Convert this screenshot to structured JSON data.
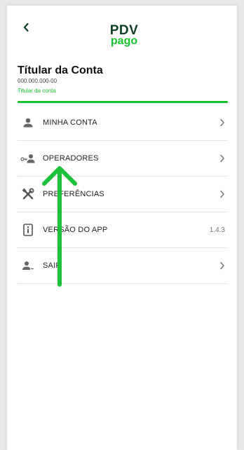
{
  "header": {
    "back_icon": "chevron-left-icon",
    "logo_line1": "PDV",
    "logo_line2": "pago"
  },
  "account": {
    "name": "Títular da Conta",
    "document": "000.000.000-00",
    "subtitle": "Titular da conta"
  },
  "menu": {
    "items": [
      {
        "label": "MINHA CONTA",
        "icon": "person-icon",
        "right": "chevron-right-icon"
      },
      {
        "label": "OPERADORES",
        "icon": "key-person-icon",
        "right": "chevron-right-icon"
      },
      {
        "label": "PREFERÊNCIAS",
        "icon": "tools-icon",
        "right": "chevron-right-icon"
      },
      {
        "label": "VERSÃO DO APP",
        "icon": "info-icon",
        "right_text": "1.4.3"
      },
      {
        "label": "SAIR",
        "icon": "person-logout-icon",
        "right": "chevron-right-icon"
      }
    ]
  },
  "colors": {
    "brand_dark": "#0d3e22",
    "brand_green": "#19c22f",
    "arrow_green": "#1ec23a"
  }
}
